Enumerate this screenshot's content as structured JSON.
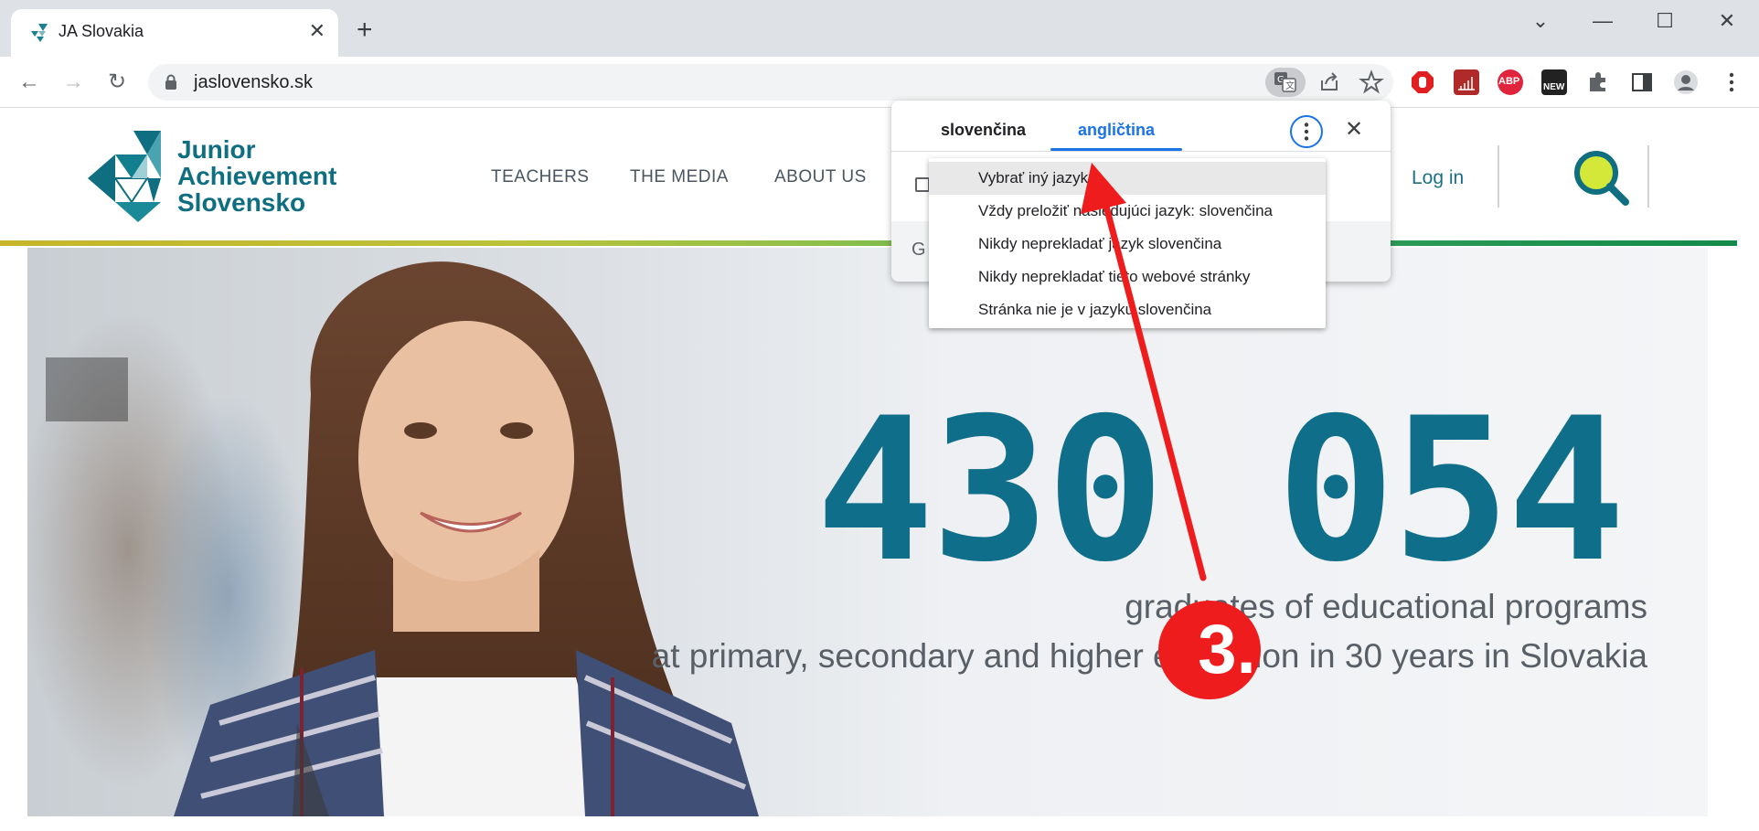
{
  "browser": {
    "tab_title": "JA Slovakia",
    "tab_close": "✕",
    "new_tab": "+",
    "url": "jaslovensko.sk",
    "window": {
      "minimize": "—",
      "maximize": "☐",
      "close": "✕",
      "tab_search": "⌄"
    },
    "nav": {
      "back": "←",
      "forward": "→",
      "reload": "↻"
    },
    "icons": [
      "translate-icon",
      "share-icon",
      "star-icon",
      "stop-extension-icon",
      "signal-extension-icon",
      "abp-icon",
      "new-extension-icon",
      "puzzle-icon",
      "sidepanel-icon",
      "profile-icon",
      "kebab-menu-icon"
    ],
    "ext_abp": "ABP",
    "ext_new": "NEW"
  },
  "site": {
    "logo_lines": [
      "Junior",
      "Achievement",
      "Slovensko"
    ],
    "nav_items": [
      "TEACHERS",
      "THE MEDIA",
      "ABOUT US"
    ],
    "login": "Log in",
    "hero": {
      "number": "430 054",
      "line1": "graduates of educational programs",
      "line2": "at primary, secondary and higher education in 30 years in Slovakia"
    },
    "colors": {
      "brand_teal": "#0f6e8a",
      "search_yellow": "#d4e83a"
    }
  },
  "translate_popup": {
    "source_lang": "slovenčina",
    "target_lang": "angličtina",
    "close": "✕",
    "footer_letter": "G",
    "menu": [
      "Vybrať iný jazyk",
      "Vždy preložiť nasledujúci jazyk: slovenčina",
      "Nikdy neprekladať jazyk slovenčina",
      "Nikdy neprekladať tieto webové stránky",
      "Stránka nie je v jazyku slovenčina"
    ],
    "highlighted_index": 0
  },
  "annotation": {
    "step": "3.",
    "color": "#ee1c1c"
  }
}
